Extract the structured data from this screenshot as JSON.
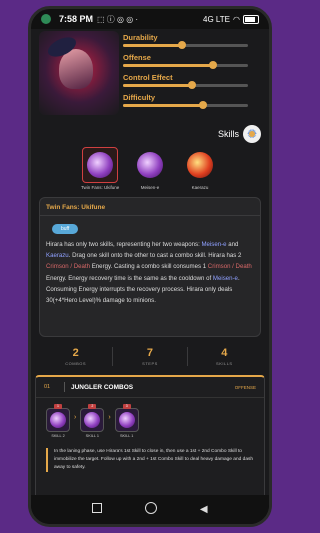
{
  "status_bar": {
    "time": "7:58 PM",
    "signal": "4G LTE",
    "battery_level": 0.7
  },
  "hero_stats": [
    {
      "label": "Durability",
      "value": 0.47
    },
    {
      "label": "Offense",
      "value": 0.72
    },
    {
      "label": "Control Effect",
      "value": 0.55
    },
    {
      "label": "Difficulty",
      "value": 0.64
    }
  ],
  "skills_header": {
    "label": "Skills"
  },
  "skills": [
    {
      "name": "Twin Fans: Ukifune",
      "style": "purple",
      "selected": true
    },
    {
      "name": "Meisen-e",
      "style": "purple",
      "selected": false
    },
    {
      "name": "Kaerazu",
      "style": "fire",
      "selected": false
    }
  ],
  "description": {
    "title": "Twin Fans: Ukifune",
    "tag": "buff",
    "line1_a": "Hirara has only two skills, representing her two weapons: ",
    "line1_hl1": "Meisen-e",
    "line1_b": " and ",
    "line1_hl2": "Kaerazu",
    "line1_c": ". Drag one skill onto the other to cast a combo skill. Hirara has 2 ",
    "energy1": "Crimson / Death",
    "line2_a": " Energy. Casting a combo skill consumes 1 ",
    "energy2": "Crimson / Death",
    "line2_b": " Energy. Energy recovery time is the same as the cooldown of ",
    "line2_hl": "Meisen-e",
    "line2_c": ". Consuming Energy interrupts the recovery process. Hirara only deals 30(+4*Hero Level)% damage to minions."
  },
  "counts": [
    {
      "value": "2",
      "label": "COMBOS"
    },
    {
      "value": "7",
      "label": "STEPS"
    },
    {
      "value": "4",
      "label": "SKILLS"
    }
  ],
  "combo": {
    "number": "01",
    "title": "JUNGLER COMBOS",
    "tag": "OFFENSE",
    "steps": [
      {
        "label": "SKILL 2",
        "badge": "1"
      },
      {
        "label": "SKILL 1",
        "badge": "2"
      },
      {
        "label": "SKILL 1",
        "badge": "3"
      }
    ],
    "text": "In the laning phase, use Hirara's 1st Skill to close in, then use a 1st + 2nd Combo Skill to immobilize the target. Follow up with a 2nd + 1st Combo Skill to deal heavy damage and dash away to safety."
  },
  "colors": {
    "accent": "#e5a84a",
    "background": "#1a1a1c",
    "frame": "#5b2a86"
  }
}
